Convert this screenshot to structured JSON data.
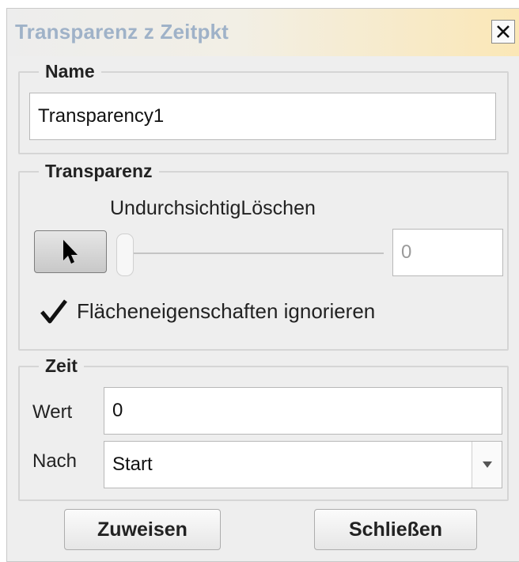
{
  "window": {
    "title": "Transparenz z Zeitpkt"
  },
  "name_group": {
    "legend": "Name",
    "value": "Transparency1"
  },
  "transparency_group": {
    "legend": "Transparenz",
    "slider_caption": "UndurchsichtigLöschen",
    "slider_value": 0,
    "value_field": "0",
    "checkbox_label": "Flächeneigenschaften ignorieren",
    "checkbox_checked": true
  },
  "time_group": {
    "legend": "Zeit",
    "wert_label": "Wert",
    "wert_value": "0",
    "nach_label": "Nach",
    "nach_value": "Start"
  },
  "footer": {
    "assign_label": "Zuweisen",
    "close_label": "Schließen"
  },
  "colors": {
    "title_text": "#9fb2c8",
    "titlebar_accent": "#fbe7b6",
    "panel_bg": "#eeeeee"
  },
  "icons": [
    "close-icon",
    "arrow-pointer-icon",
    "checkmark-icon",
    "dropdown-arrow-icon"
  ]
}
